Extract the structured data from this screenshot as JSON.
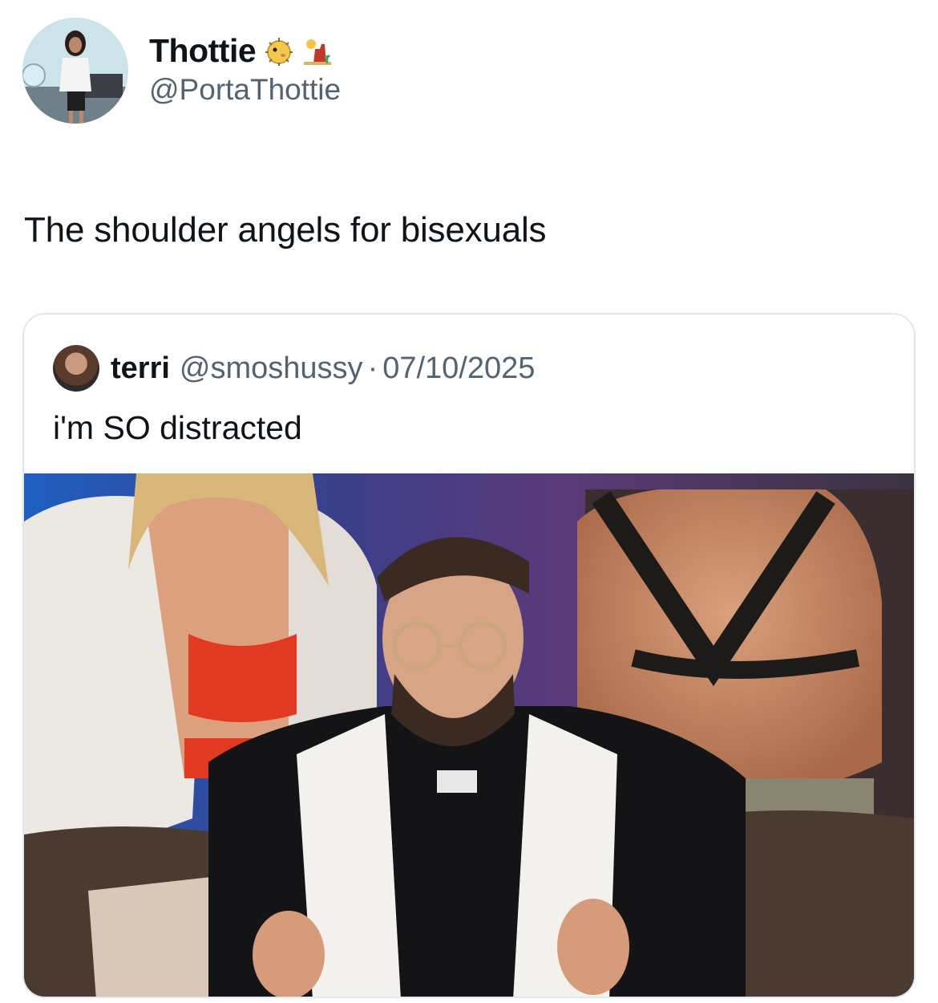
{
  "author": {
    "display_name": "Thottie",
    "handle": "@PortaThottie",
    "emoji_icons": [
      "blowfish-icon",
      "desert-icon"
    ]
  },
  "tweet": {
    "text": "The shoulder angels for bisexuals"
  },
  "quoted_tweet": {
    "display_name": "terri",
    "handle": "@smoshussy",
    "separator": "·",
    "date": "07/10/2025",
    "text": "i'm SO distracted"
  },
  "colors": {
    "secondary_text": "#536471",
    "border": "#e1e8ed",
    "primary_text": "#0f1419"
  }
}
